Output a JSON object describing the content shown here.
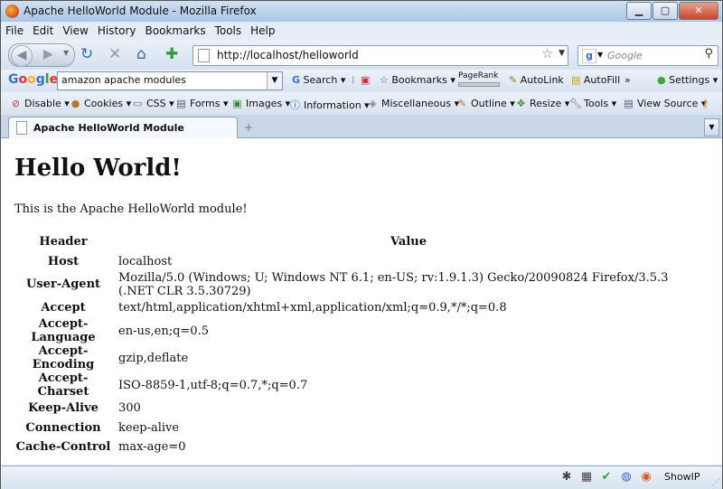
{
  "window": {
    "title": "Apache HelloWorld Module - Mozilla Firefox"
  },
  "menu": [
    "File",
    "Edit",
    "View",
    "History",
    "Bookmarks",
    "Tools",
    "Help"
  ],
  "nav": {
    "url": "http://localhost/helloworld",
    "search_placeholder": "Google"
  },
  "google_toolbar": {
    "query": "amazon apache modules",
    "search_label": "Search",
    "bookmarks_label": "Bookmarks",
    "pagerank_label": "PageRank",
    "autolink_label": "AutoLink",
    "autofill_label": "AutoFill",
    "more_label": "»",
    "settings_label": "Settings"
  },
  "webdev_toolbar": {
    "disable": "Disable",
    "cookies": "Cookies",
    "css": "CSS",
    "forms": "Forms",
    "images": "Images",
    "information": "Information",
    "miscellaneous": "Miscellaneous",
    "outline": "Outline",
    "resize": "Resize",
    "tools": "Tools",
    "view_source": "View Source"
  },
  "tab": {
    "title": "Apache HelloWorld Module",
    "new_tab": "+"
  },
  "page": {
    "heading": "Hello World!",
    "intro": "This is the Apache HelloWorld module!",
    "table_headers": [
      "Header",
      "Value"
    ],
    "rows": [
      {
        "header": "Host",
        "value": "localhost"
      },
      {
        "header": "User-Agent",
        "value": "Mozilla/5.0 (Windows; U; Windows NT 6.1; en-US; rv:1.9.1.3) Gecko/20090824 Firefox/3.5.3 (.NET CLR 3.5.30729)"
      },
      {
        "header": "Accept",
        "value": "text/html,application/xhtml+xml,application/xml;q=0.9,*/*;q=0.8"
      },
      {
        "header": "Accept-Language",
        "value": "en-us,en;q=0.5"
      },
      {
        "header": "Accept-Encoding",
        "value": "gzip,deflate"
      },
      {
        "header": "Accept-Charset",
        "value": "ISO-8859-1,utf-8;q=0.7,*;q=0.7"
      },
      {
        "header": "Keep-Alive",
        "value": "300"
      },
      {
        "header": "Connection",
        "value": "keep-alive"
      },
      {
        "header": "Cache-Control",
        "value": "max-age=0"
      }
    ]
  },
  "status": {
    "showip": "ShowIP"
  }
}
